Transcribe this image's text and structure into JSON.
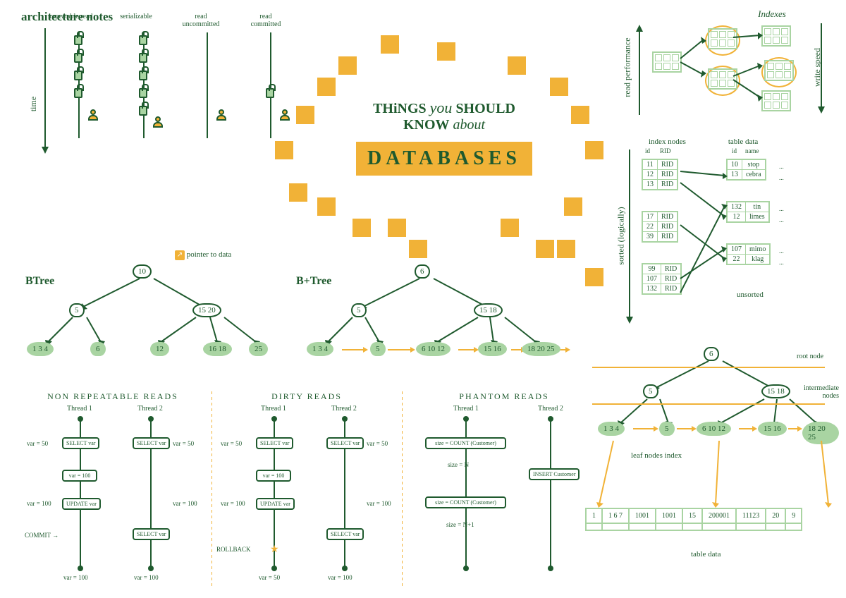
{
  "header": {
    "title": "architecture notes"
  },
  "center_title": {
    "line1a": "THiNGS",
    "line1b": "you",
    "line1c": "SHOULD",
    "line2a": "KNOW",
    "line2b": "about",
    "big": "DATABASES"
  },
  "isolation": {
    "time_label": "time",
    "levels": [
      "repeatable read",
      "serializable",
      "read uncommitted",
      "read committed"
    ]
  },
  "btree": {
    "label": "BTree",
    "root": "10",
    "mid_left": "5",
    "mid_right": "15 20",
    "leaves": [
      "1 3 4",
      "6",
      "12",
      "16 18",
      "25"
    ],
    "pointer_legend": "pointer to data"
  },
  "bplustree": {
    "label": "B+Tree",
    "root": "6",
    "mid_left": "5",
    "mid_right": "15 18",
    "leaves": [
      "1 3 4",
      "5",
      "6 10 12",
      "15 16",
      "18 20 25"
    ]
  },
  "anomalies": {
    "nonrepeatable": {
      "title": "NON REPEATABLE READS",
      "thread1": "Thread 1",
      "thread2": "Thread 2",
      "t1_ops": [
        "SELECT var",
        "var = 100",
        "UPDATE var"
      ],
      "t1_side": [
        "var = 50",
        "var = 100",
        "COMMIT →",
        "var = 100"
      ],
      "t2_ops": [
        "SELECT var",
        "SELECT var"
      ],
      "t2_side": [
        "var = 50",
        "var = 100",
        "var = 100"
      ]
    },
    "dirty": {
      "title": "DIRTY READS",
      "thread1": "Thread 1",
      "thread2": "Thread 2",
      "t1_ops": [
        "SELECT var",
        "var = 100",
        "UPDATE var"
      ],
      "t1_side": [
        "var = 50",
        "var = 100",
        "ROLLBACK",
        "var = 50"
      ],
      "t2_ops": [
        "SELECT var",
        "SELECT var"
      ],
      "t2_side": [
        "var = 50",
        "var = 100",
        "var = 100"
      ]
    },
    "phantom": {
      "title": "PHANTOM READS",
      "thread1": "Thread 1",
      "thread2": "Thread 2",
      "t1_ops": [
        "size = COUNT (Customer)",
        "size = N",
        "size = COUNT (Customer)",
        "size = N+1"
      ],
      "t2_ops": [
        "INSERT Customer"
      ]
    }
  },
  "indexes": {
    "title": "Indexes",
    "yaxis": "read performance",
    "yaxis2": "write speed"
  },
  "index_map": {
    "left_header": "index nodes",
    "right_header": "table data",
    "left_cols": [
      "id",
      "RID"
    ],
    "right_cols": [
      "id",
      "name"
    ],
    "sorted_label": "sorted (logically)",
    "unsorted_label": "unsorted",
    "left_group1": [
      [
        "11",
        "RID"
      ],
      [
        "12",
        "RID"
      ],
      [
        "13",
        "RID"
      ]
    ],
    "left_group2": [
      [
        "17",
        "RID"
      ],
      [
        "22",
        "RID"
      ],
      [
        "39",
        "RID"
      ]
    ],
    "left_group3": [
      [
        "99",
        "RID"
      ],
      [
        "107",
        "RID"
      ],
      [
        "132",
        "RID"
      ]
    ],
    "right_rows": [
      [
        "10",
        "stop"
      ],
      [
        "13",
        "cebra"
      ],
      [
        "132",
        "tin"
      ],
      [
        "12",
        "limes"
      ],
      [
        "107",
        "mimo"
      ],
      [
        "22",
        "klag"
      ]
    ],
    "dots": "..."
  },
  "bptree_layers": {
    "root": "6",
    "mid_left": "5",
    "mid_right": "15 18",
    "leaves": [
      "1 3 4",
      "5",
      "6 10 12",
      "15 16",
      "18 20 25"
    ],
    "root_label": "root node",
    "mid_label": "intermediate nodes",
    "leaf_label": "leaf nodes index",
    "table_label": "table data",
    "table_row": [
      "1",
      "1 6 7",
      "1001",
      "1001",
      "15",
      "200001",
      "11123",
      "20",
      "9"
    ]
  }
}
